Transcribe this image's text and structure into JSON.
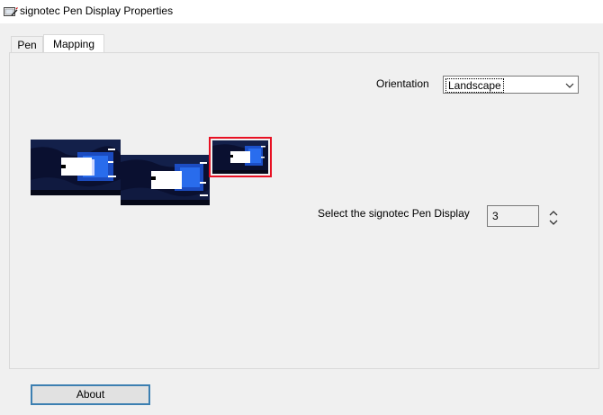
{
  "window": {
    "title": "signotec Pen Display Properties"
  },
  "tabs": [
    {
      "label": "Pen",
      "selected": false
    },
    {
      "label": "Mapping",
      "selected": true
    }
  ],
  "mapping": {
    "orientation_label": "Orientation",
    "orientation_value": "Landscape",
    "select_display_label": "Select the signotec Pen Display",
    "display_number": "3",
    "monitors": [
      {
        "id": 1,
        "selected": false
      },
      {
        "id": 2,
        "selected": false
      },
      {
        "id": 3,
        "selected": true
      }
    ]
  },
  "buttons": {
    "about_label": "About"
  },
  "colors": {
    "selection_border": "#e81123",
    "button_border": "#3c7fb1",
    "desktop_background": "#0a1030"
  }
}
